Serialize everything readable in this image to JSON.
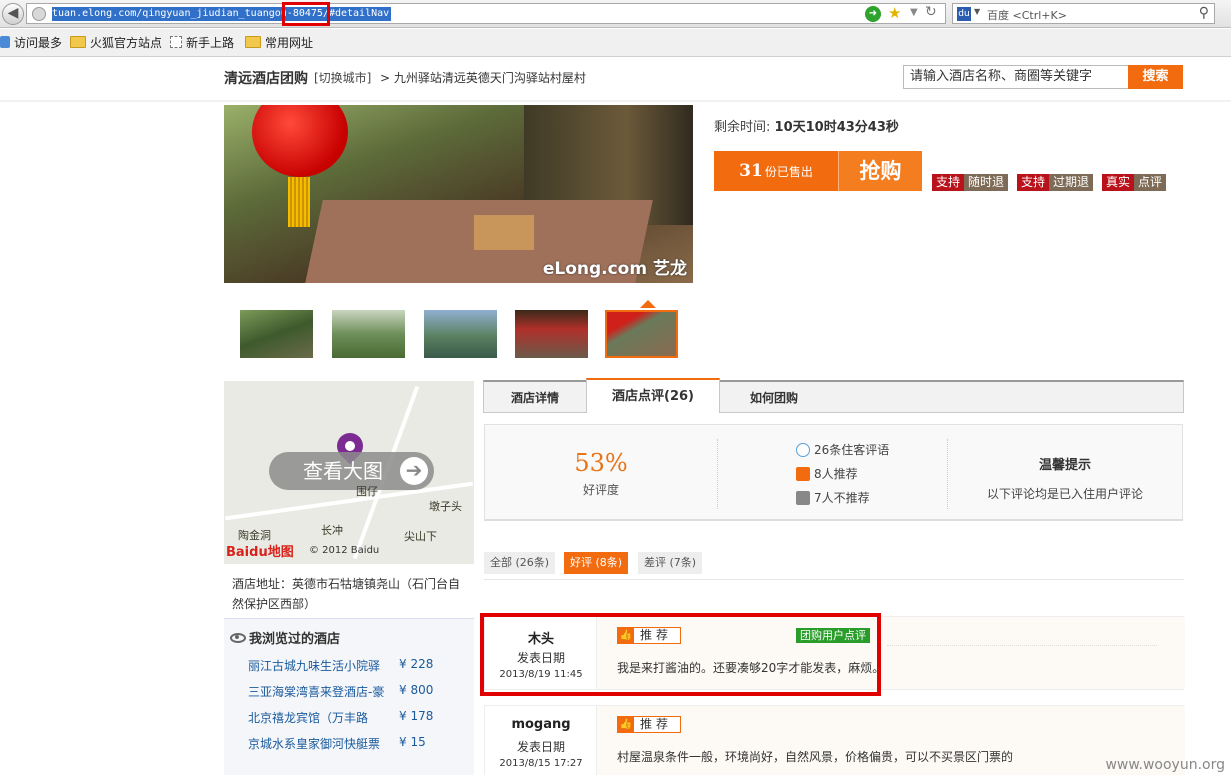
{
  "browser": {
    "url": "tuan.elong.com/qingyuan_jiudian_tuangou-80475/#detailNav",
    "search_engine": "百度",
    "search_placeholder": "<Ctrl+K>",
    "bookmarks": [
      "访问最多",
      "火狐官方站点",
      "新手上路",
      "常用网址"
    ]
  },
  "header": {
    "site_title": "清远酒店团购",
    "switch_city": "[切换城市]",
    "breadcrumb": "> 九州驿站清远英德天门沟驿站村屋村",
    "search_value": "请输入酒店名称、商圈等关键字",
    "search_button": "搜索"
  },
  "photo": {
    "watermark": "eLong.com 艺龙"
  },
  "deal": {
    "remaining_label": "剩余时间:",
    "remaining_value": "10天10时43分43秒",
    "sold_count": "31",
    "sold_label": "份已售出",
    "buy_label": "抢购",
    "badges": [
      {
        "a": "支持",
        "b": "随时退"
      },
      {
        "a": "支持",
        "b": "过期退"
      },
      {
        "a": "真实",
        "b": "点评"
      }
    ]
  },
  "map": {
    "view_big": "查看大图",
    "labels": [
      "围仔",
      "墩子头",
      "长冲",
      "尖山下",
      "陶金洞"
    ],
    "baidu_logo": "Baidu地图",
    "copyright": "© 2012 Baidu"
  },
  "address": "酒店地址：英德市石牯塘镇尧山（石门台自然保护区西部）",
  "viewed": {
    "title": "我浏览过的酒店",
    "items": [
      {
        "name": "丽江古城九味生活小院驿",
        "price": "¥ 228"
      },
      {
        "name": "三亚海棠湾喜来登酒店-豪",
        "price": "¥ 800"
      },
      {
        "name": "北京禧龙宾馆（万丰路",
        "price": "¥ 178"
      },
      {
        "name": "京城水系皇家御河快艇票",
        "price": "¥ 15"
      }
    ]
  },
  "tabs": [
    "酒店详情",
    "酒店点评(26)",
    "如何团购"
  ],
  "summary": {
    "good_rate": "53%",
    "good_rate_label": "好评度",
    "stats": [
      "26条住客评语",
      "8人推荐",
      "7人不推荐"
    ],
    "tip_title": "温馨提示",
    "tip_text": "以下评论均是已入住用户评论"
  },
  "filters": [
    "全部 (26条)",
    "好评 (8条)",
    "差评 (7条)"
  ],
  "reviews": [
    {
      "name": "木头",
      "date_label": "发表日期",
      "date": "2013/8/19 11:45",
      "tag": "推荐",
      "tag2": "团购用户点评",
      "text": "我是来打酱油的。还要凑够20字才能发表，麻烦。"
    },
    {
      "name": "mogang",
      "date_label": "发表日期",
      "date": "2013/8/15 17:27",
      "tag": "推荐",
      "tag2": "",
      "text": "村屋温泉条件一般，环境尚好，自然风景，价格偏贵，可以不买景区门票的"
    }
  ],
  "watermark_site": "www.wooyun.org",
  "colors": {
    "accent": "#f26b0f",
    "highlight": "#e10000",
    "badge_red": "#b9121b",
    "link": "#1a5a9c"
  }
}
